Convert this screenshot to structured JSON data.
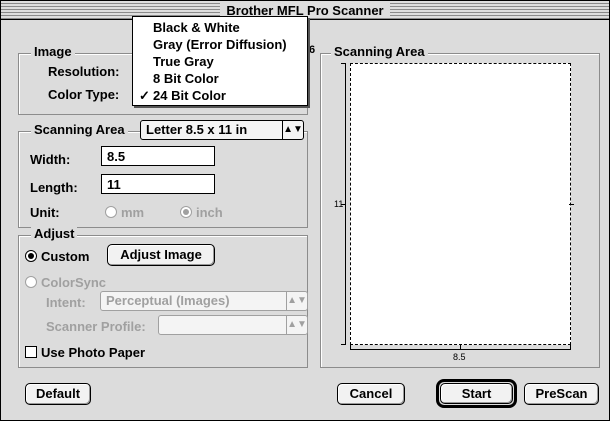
{
  "window": {
    "title": "Brother MFL Pro Scanner"
  },
  "image_group": {
    "label": "Image",
    "resolution_label": "Resolution:",
    "color_type_label": "Color Type:"
  },
  "color_menu": {
    "items": [
      {
        "label": "Black & White",
        "checked": false
      },
      {
        "label": "Gray (Error Diffusion)",
        "checked": false
      },
      {
        "label": "True Gray",
        "checked": false
      },
      {
        "label": "8 Bit Color",
        "checked": false
      },
      {
        "label": "24 Bit Color",
        "checked": true
      }
    ],
    "check_glyph": "✓"
  },
  "scan_group": {
    "label": "Scanning Area",
    "size_value": "Letter 8.5 x 11 in",
    "width_label": "Width:",
    "width_value": "8.5",
    "length_label": "Length:",
    "length_value": "11",
    "unit_label": "Unit:",
    "unit_mm": "mm",
    "unit_inch": "inch"
  },
  "adjust_group": {
    "label": "Adjust",
    "custom_label": "Custom",
    "adjust_image_button": "Adjust Image",
    "colorsync_label": "ColorSync",
    "intent_label": "Intent:",
    "intent_value": "Perceptual (Images)",
    "profile_label": "Scanner Profile:",
    "profile_value": "",
    "photo_paper_label": "Use Photo Paper"
  },
  "preview": {
    "label": "Scanning Area",
    "left_ruler_label": "11",
    "bottom_ruler_label": "8.5"
  },
  "buttons": {
    "default": "Default",
    "cancel": "Cancel",
    "start": "Start",
    "prescan": "PreScan"
  },
  "fragment": {
    "digit": "6"
  }
}
